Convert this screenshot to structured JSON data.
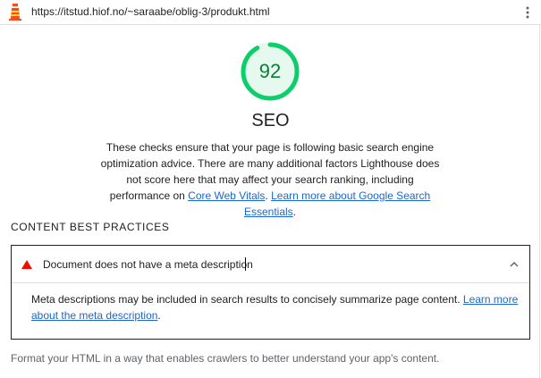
{
  "topbar": {
    "url": "https://itstud.hiof.no/~saraabe/oblig-3/produkt.html"
  },
  "score": {
    "value": "92",
    "fraction": 0.92,
    "color": "#0cce6b"
  },
  "category": {
    "title": "SEO",
    "description_part1": "These checks ensure that your page is following basic search engine optimization advice. There are many additional factors Lighthouse does not score here that may affect your search ranking, including performance on ",
    "link_core_web_vitals": "Core Web Vitals",
    "separator": ". ",
    "link_search_essentials": "Learn more about Google Search Essentials",
    "end": "."
  },
  "group": {
    "title": "CONTENT BEST PRACTICES"
  },
  "audit": {
    "title": "Document does not have a meta description",
    "status_icon": "fail-triangle-icon",
    "description": "Meta descriptions may be included in search results to concisely summarize page content. ",
    "link": "Learn more about the meta description",
    "end": "."
  },
  "footer": {
    "text": "Format your HTML in a way that enables crawlers to better understand your app's content."
  },
  "colors": {
    "link": "#1967d2",
    "fail": "#eb0f00",
    "pass": "#0cce6b"
  }
}
